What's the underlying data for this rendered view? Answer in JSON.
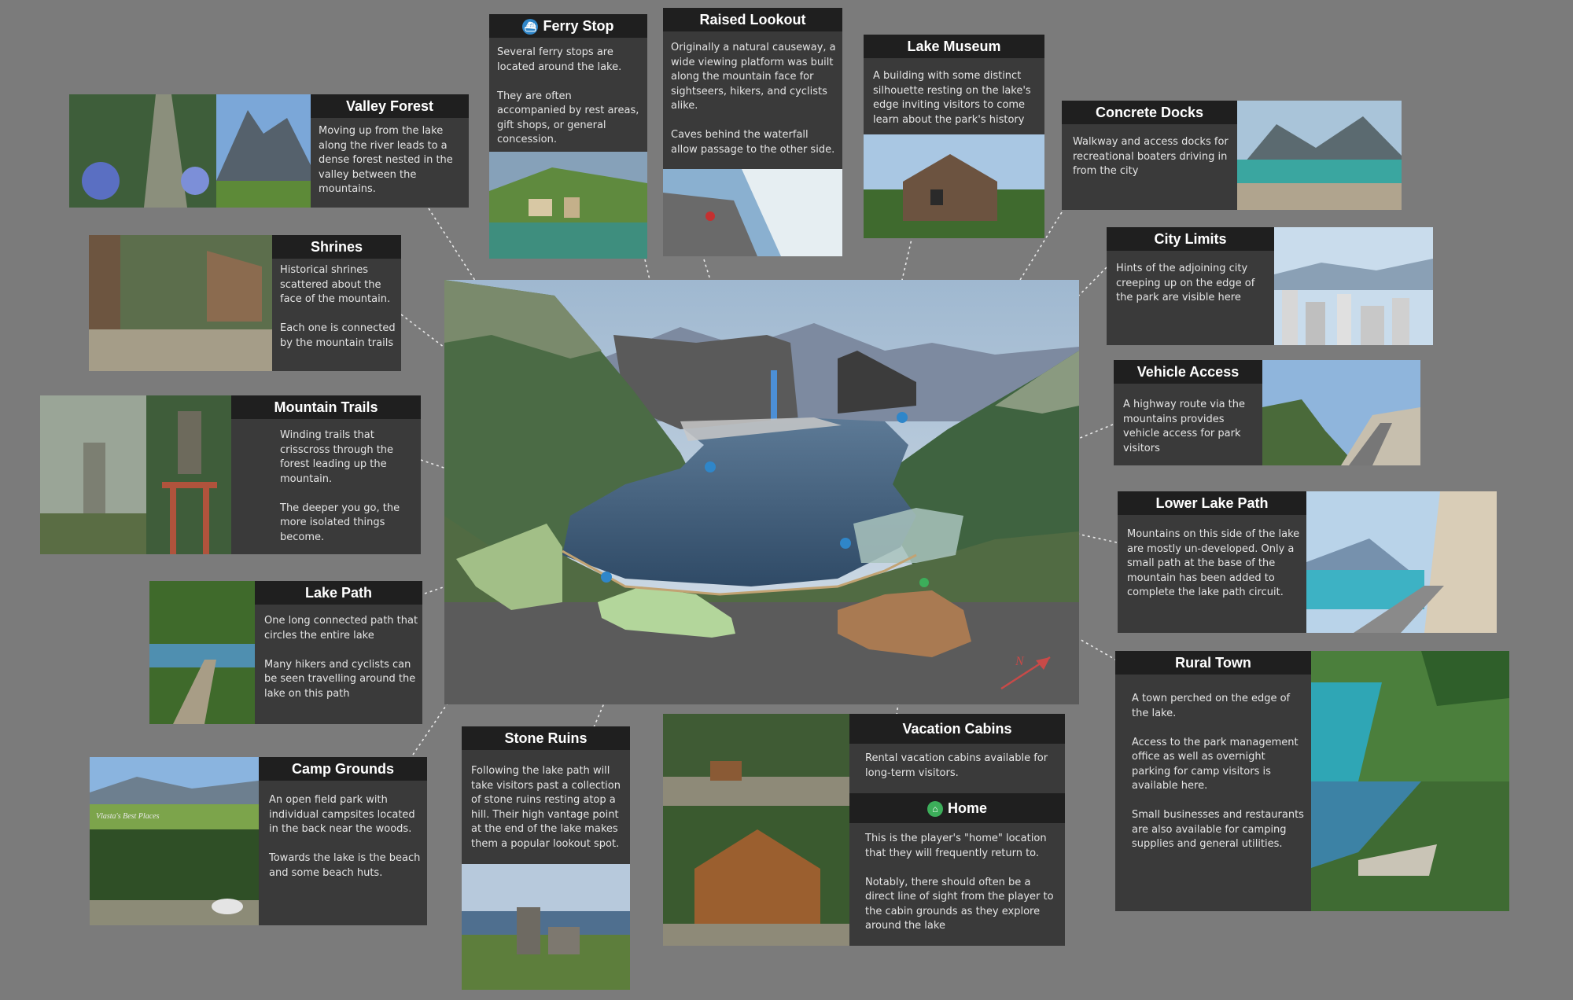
{
  "cards": {
    "ferry_stop": {
      "title": "Ferry Stop",
      "body": "Several ferry stops are located around the lake.\n\nThey are often accompanied by rest areas, gift shops, or general concession."
    },
    "raised_lookout": {
      "title": "Raised Lookout",
      "body": "Originally a natural causeway, a wide viewing platform was built along the mountain face for sightseers, hikers, and cyclists alike.\n\nCaves behind the waterfall allow passage to the other side."
    },
    "lake_museum": {
      "title": "Lake Museum",
      "body": "A building with some distinct silhouette resting on the lake's edge inviting visitors to come learn about the park's history"
    },
    "valley_forest": {
      "title": "Valley Forest",
      "body": "Moving up from the lake along the river leads to a dense forest nested in the valley between the mountains."
    },
    "concrete_docks": {
      "title": "Concrete Docks",
      "body": "Walkway and access docks for recreational boaters driving in from the city"
    },
    "shrines": {
      "title": "Shrines",
      "body": "Historical shrines scattered about the face of the mountain.\n\nEach one is connected by the mountain trails"
    },
    "city_limits": {
      "title": "City Limits",
      "body": "Hints of the adjoining city creeping up on the edge of the park are visible here"
    },
    "vehicle_access": {
      "title": "Vehicle Access",
      "body": "A highway route via the mountains provides vehicle access for park visitors"
    },
    "mountain_trails": {
      "title": "Mountain Trails",
      "body": "Winding trails that crisscross through the forest leading up the mountain.\n\nThe deeper you go, the more isolated things become."
    },
    "lower_lake_path": {
      "title": "Lower Lake Path",
      "body": "Mountains on this side of the lake are mostly un-developed. Only a small path at the base of the mountain has been added to complete the lake path circuit."
    },
    "lake_path": {
      "title": "Lake Path",
      "body": "One long connected path that circles the entire lake\n\nMany hikers and cyclists can be seen travelling around the lake on this path"
    },
    "rural_town": {
      "title": "Rural Town",
      "body": "A town perched on the edge of the lake.\n\nAccess to the park management office as well as overnight parking for camp visitors is available here.\n\nSmall businesses and restaurants are also available for camping supplies and general utilities."
    },
    "camp_grounds": {
      "title": "Camp Grounds",
      "body": "An open field park with individual campsites located in the back near the woods.\n\nTowards the lake is the beach and some beach huts."
    },
    "stone_ruins": {
      "title": "Stone Ruins",
      "body": "Following the lake path will take visitors past a collection of stone ruins resting atop a hill. Their high vantage point at the end of the lake makes them a popular lookout spot."
    },
    "vacation_cabins": {
      "title": "Vacation Cabins",
      "body": "Rental vacation cabins available for long-term visitors."
    },
    "home": {
      "title": "Home",
      "body": "This is the player's \"home\" location that they will frequently return to.\n\nNotably, there should often be a direct line of sight from the player to the cabin grounds as they explore around the lake"
    }
  },
  "map": {
    "compass_label": "N"
  },
  "watermarks": {
    "camp_photo": "Vlasta's Best Places"
  },
  "colors": {
    "card_bg": "#3a3a3a",
    "title_bg": "#1f1f1f",
    "page_bg": "#7b7b7b",
    "pin_blue": "#2f86c9",
    "pin_green": "#3cae5a",
    "compass": "#c84a48"
  },
  "icons": {
    "ferry": "ferry-pin-icon",
    "home": "home-pin-icon",
    "compass": "north-arrow-icon"
  }
}
